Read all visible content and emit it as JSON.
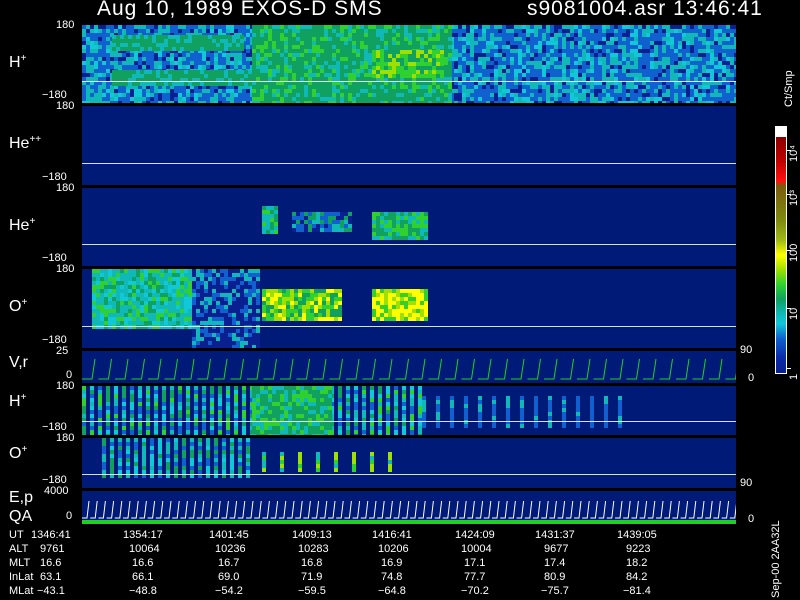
{
  "title": {
    "left": "Aug 10, 1989    EXOS-D SMS",
    "right": "s9081004.asr   13:46:41"
  },
  "colors": {
    "background": "#000000",
    "panel_bg": "#001a78",
    "trace": "#20d020",
    "accent": "#ffffff"
  },
  "colorbar": {
    "unit": "Ct/Smp",
    "labels": [
      "10⁴",
      "10³",
      "100",
      "10",
      "1"
    ],
    "scale": "log",
    "range": [
      1,
      10000
    ]
  },
  "panels": [
    {
      "name": "H+",
      "label": "H",
      "sup": "+",
      "ymax": "180",
      "ymin": "−180"
    },
    {
      "name": "He++",
      "label": "He",
      "sup": "++",
      "ymax": "180",
      "ymin": "−180"
    },
    {
      "name": "He+",
      "label": "He",
      "sup": "+",
      "ymax": "180",
      "ymin": "−180"
    },
    {
      "name": "O+",
      "label": "O",
      "sup": "+",
      "ymax": "180",
      "ymin": "−180"
    },
    {
      "name": "V,r",
      "label": "V,r",
      "sup": "",
      "ymax": "25",
      "ymin": "0",
      "right_top": "90",
      "right_bot": "0"
    },
    {
      "name": "H+ (lower)",
      "label": "H",
      "sup": "+",
      "ymax": "180",
      "ymin": "−180"
    },
    {
      "name": "O+ (lower)",
      "label": "O",
      "sup": "+",
      "ymax": "180",
      "ymin": "−180",
      "right_bot": "90"
    },
    {
      "name": "E,p QA",
      "label": "E,p",
      "label2": "QA",
      "sup": "",
      "ymax": "4000",
      "ymin": "0",
      "right_bot": "0"
    }
  ],
  "orbit_label": "Sep-00  2AA32L",
  "table": {
    "rows": [
      {
        "key": "UT",
        "values": [
          "1346:41",
          "1354:17",
          "1401:45",
          "1409:13",
          "1416:41",
          "1424:09",
          "1431:37",
          "1439:05"
        ]
      },
      {
        "key": "ALT",
        "values": [
          "9761",
          "10064",
          "10236",
          "10283",
          "10206",
          "10004",
          "9677",
          "9223"
        ]
      },
      {
        "key": "MLT",
        "values": [
          "16.6",
          "16.6",
          "16.7",
          "16.8",
          "16.9",
          "17.1",
          "17.4",
          "18.2"
        ]
      },
      {
        "key": "InLat",
        "values": [
          "63.1",
          "66.1",
          "69.0",
          "71.9",
          "74.8",
          "77.7",
          "80.9",
          "84.2"
        ]
      },
      {
        "key": "MLat",
        "values": [
          "−43.1",
          "−48.8",
          "−54.2",
          "−59.5",
          "−64.8",
          "−70.2",
          "−75.7",
          "−81.4"
        ]
      }
    ]
  },
  "chart_data": {
    "type": "heatmap",
    "title": "Aug 10, 1989    EXOS-D SMS",
    "xlabel": "UT",
    "x": [
      "1346:41",
      "1354:17",
      "1401:45",
      "1409:13",
      "1416:41",
      "1424:09",
      "1431:37",
      "1439:05"
    ],
    "series": [
      {
        "name": "H+",
        "ylim": [
          -180,
          180
        ]
      },
      {
        "name": "He++",
        "ylim": [
          -180,
          180
        ]
      },
      {
        "name": "He+",
        "ylim": [
          -180,
          180
        ]
      },
      {
        "name": "O+",
        "ylim": [
          -180,
          180
        ]
      },
      {
        "name": "V,r",
        "ylim": [
          0,
          25
        ]
      },
      {
        "name": "H+",
        "ylim": [
          -180,
          180
        ]
      },
      {
        "name": "O+",
        "ylim": [
          -180,
          180
        ]
      },
      {
        "name": "E,p",
        "ylim": [
          0,
          4000
        ]
      }
    ],
    "colorscale_range": [
      1,
      10000
    ]
  }
}
